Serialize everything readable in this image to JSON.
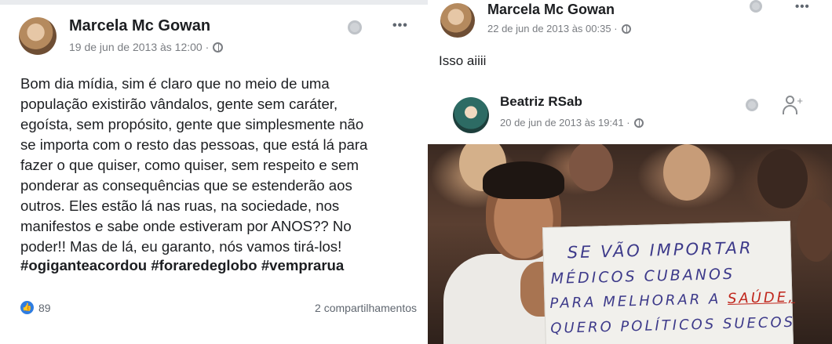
{
  "colors": {
    "accent": "#2f7de1",
    "text": "#1c1e21",
    "muted": "#7a7d82",
    "sign_red": "#c0261c",
    "sign_blue": "#3d3a8a"
  },
  "left_post": {
    "author": "Marcela Mc Gowan",
    "timestamp": "19 de jun de 2013 às 12:00 ·",
    "privacy_icon": "globe-icon",
    "more_label": "•••",
    "body_lines": [
      "Bom dia mídia, sim é claro que no meio de uma",
      "população existirão vândalos, gente sem caráter,",
      "egoísta, sem propósito, gente que simplesmente não",
      "se importa com o resto das pessoas, que está lá para",
      "fazer o que quiser, como quiser, sem respeito e sem",
      "ponderar as consequências que se estenderão aos",
      "outros. Eles estão lá nas ruas, na sociedade, nos",
      "manifestos e sabe onde estiveram por ANOS?? No",
      "poder!! Mas de lá, eu garanto, nós vamos tirá-los!"
    ],
    "hashtags": "#ogiganteacordou #foraredeglobo #vemprarua",
    "reaction_count": "89",
    "shares": "2 compartilhamentos"
  },
  "right_post": {
    "author": "Marcela Mc Gowan",
    "timestamp": "22 de jun de 2013 às 00:35 ·",
    "more_label": "•••",
    "text": "Isso aiiii",
    "shared": {
      "author": "Beatriz RSab",
      "timestamp": "20 de jun de 2013 às 19:41 ·"
    },
    "sign_lines": {
      "l1": "SE VÃO IMPORTAR",
      "l2": "MÉDICOS CUBANOS",
      "l3_prefix": "PARA MELHORAR A ",
      "l3_highlight": "SAÚDE,",
      "l4": "QUERO POLÍTICOS SUECOS"
    }
  }
}
